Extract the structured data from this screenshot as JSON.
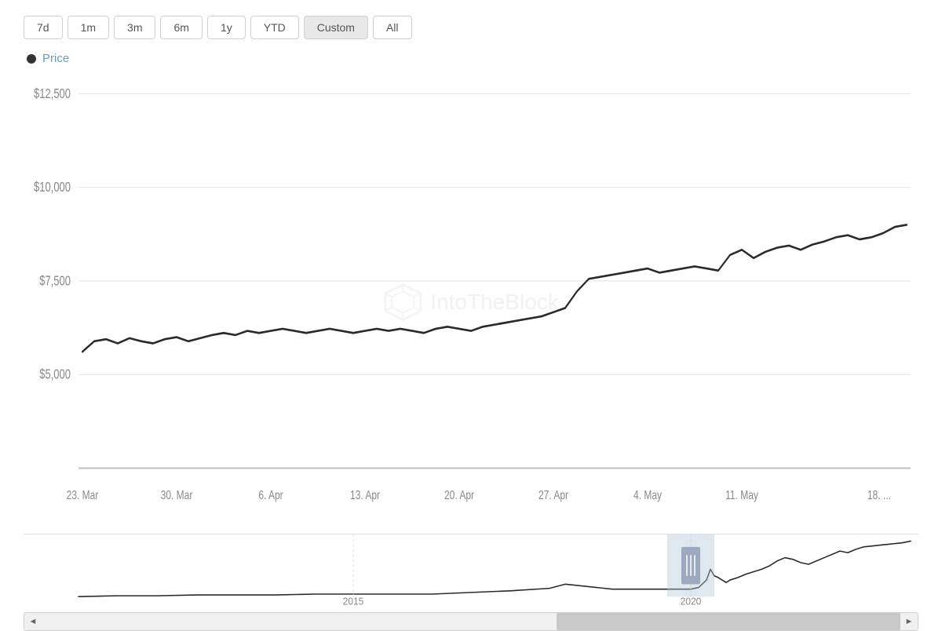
{
  "timeRange": {
    "buttons": [
      {
        "label": "7d",
        "active": false
      },
      {
        "label": "1m",
        "active": false
      },
      {
        "label": "3m",
        "active": false
      },
      {
        "label": "6m",
        "active": false
      },
      {
        "label": "1y",
        "active": false
      },
      {
        "label": "YTD",
        "active": false
      },
      {
        "label": "Custom",
        "active": true
      },
      {
        "label": "All",
        "active": false
      }
    ]
  },
  "legend": {
    "label": "Price"
  },
  "yAxis": {
    "labels": [
      "$12,500",
      "$10,000",
      "$7,500",
      "$5,000"
    ]
  },
  "xAxis": {
    "labels": [
      "23. Mar",
      "30. Mar",
      "6. Apr",
      "13. Apr",
      "20. Apr",
      "27. Apr",
      "4. May",
      "11. May",
      "18. ..."
    ]
  },
  "miniChart": {
    "yearLabels": [
      "2015",
      "2020"
    ]
  },
  "watermark": "IntoTheBlock",
  "scrollbar": {
    "leftArrow": "◄",
    "rightArrow": "►"
  }
}
